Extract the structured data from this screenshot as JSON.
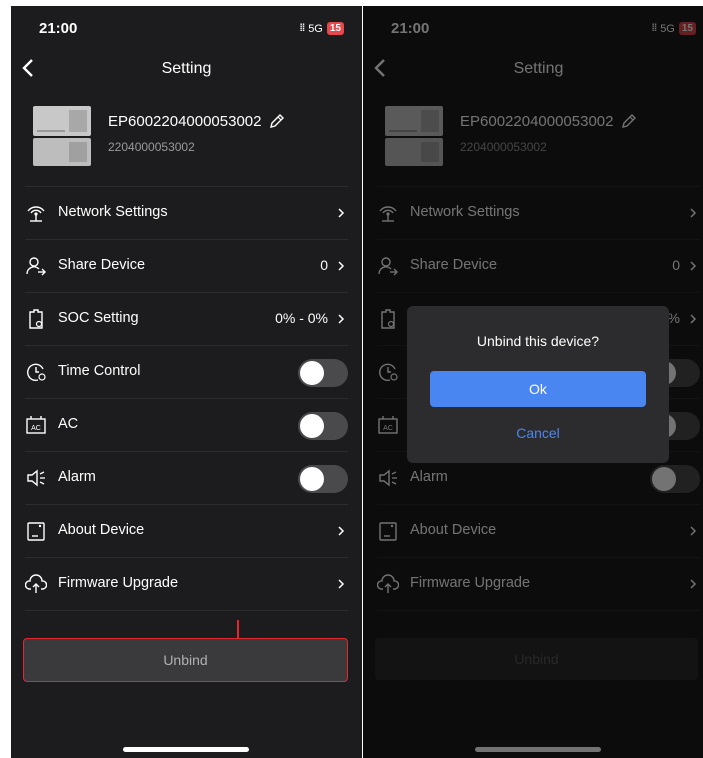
{
  "status": {
    "time": "21:00",
    "network": "5G",
    "battery": "15"
  },
  "header": {
    "title": "Setting"
  },
  "device": {
    "name": "EP6002204000053002",
    "serial": "2204000053002"
  },
  "menu": {
    "network": {
      "label": "Network Settings",
      "icon": "network-icon"
    },
    "share": {
      "label": "Share Device",
      "value": "0",
      "icon": "share-user-icon"
    },
    "soc": {
      "label": "SOC Setting",
      "value": "0% - 0%",
      "icon": "battery-soc-icon"
    },
    "time": {
      "label": "Time Control",
      "icon": "clock-icon",
      "on": false
    },
    "ac": {
      "label": "AC",
      "icon": "ac-icon",
      "on": false
    },
    "alarm": {
      "label": "Alarm",
      "icon": "speaker-icon",
      "on": false
    },
    "about": {
      "label": "About Device",
      "icon": "device-info-icon"
    },
    "firmware": {
      "label": "Firmware Upgrade",
      "icon": "cloud-upload-icon"
    }
  },
  "unbind_label": "Unbind",
  "dialog": {
    "title": "Unbind this device?",
    "ok": "Ok",
    "cancel": "Cancel"
  },
  "colors": {
    "background": "#1c1c1e",
    "accent": "#4a86f2",
    "highlight": "#e0282e"
  }
}
